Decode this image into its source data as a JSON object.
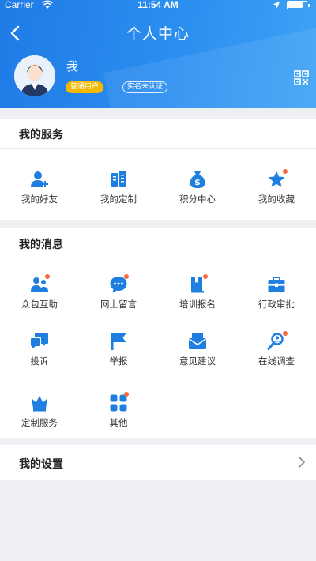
{
  "status_bar": {
    "carrier": "Carrier",
    "time": "11:54 AM"
  },
  "nav": {
    "title": "个人中心"
  },
  "profile": {
    "name": "我",
    "member_badge": "普通用户",
    "realname_badge": "实名未认证"
  },
  "services": {
    "title": "我的服务",
    "items": [
      {
        "label": "我的好友",
        "icon": "friend-icon",
        "dot": false
      },
      {
        "label": "我的定制",
        "icon": "customize-icon",
        "dot": false
      },
      {
        "label": "积分中心",
        "icon": "points-icon",
        "dot": false
      },
      {
        "label": "我的收藏",
        "icon": "star-icon",
        "dot": true
      }
    ]
  },
  "messages": {
    "title": "我的消息",
    "items": [
      {
        "label": "众包互助",
        "icon": "crowd-help-icon",
        "dot": true
      },
      {
        "label": "网上留言",
        "icon": "message-bubble-icon",
        "dot": true
      },
      {
        "label": "培训报名",
        "icon": "training-book-icon",
        "dot": true
      },
      {
        "label": "行政审批",
        "icon": "briefcase-icon",
        "dot": false
      },
      {
        "label": "投诉",
        "icon": "complaint-chat-icon",
        "dot": false
      },
      {
        "label": "举报",
        "icon": "flag-icon",
        "dot": false
      },
      {
        "label": "意见建议",
        "icon": "envelope-icon",
        "dot": false
      },
      {
        "label": "在线调查",
        "icon": "survey-search-icon",
        "dot": true
      },
      {
        "label": "定制服务",
        "icon": "crown-icon",
        "dot": false
      },
      {
        "label": "其他",
        "icon": "apps-grid-icon",
        "dot": true
      }
    ]
  },
  "settings": {
    "title": "我的设置"
  },
  "colors": {
    "primary": "#2185ea",
    "icon_blue": "#1e7fe0",
    "badge_yellow": "#f5b800",
    "dot_orange": "#f46a3c"
  }
}
